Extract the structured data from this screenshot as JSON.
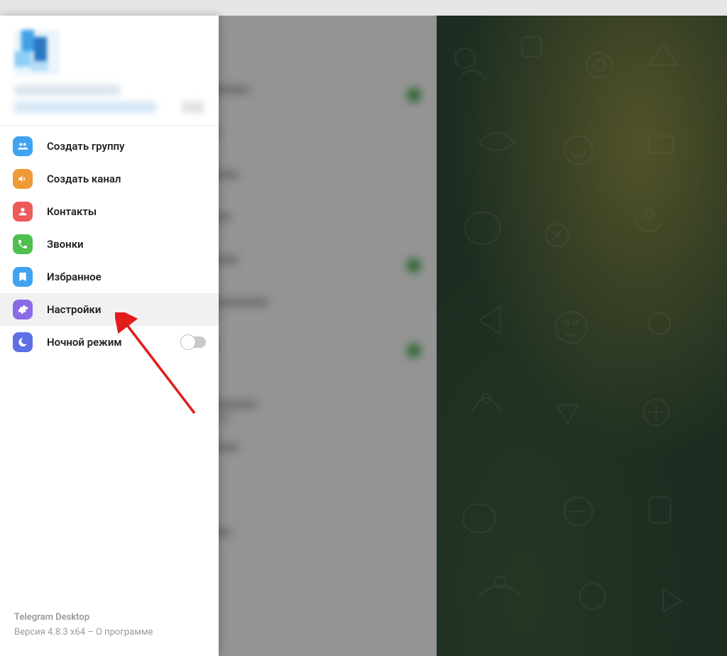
{
  "menu": {
    "new_group": {
      "label": "Создать группу",
      "icon": "group-icon"
    },
    "new_channel": {
      "label": "Создать канал",
      "icon": "megaphone-icon"
    },
    "contacts": {
      "label": "Контакты",
      "icon": "contact-icon"
    },
    "calls": {
      "label": "Звонки",
      "icon": "phone-icon"
    },
    "saved": {
      "label": "Избранное",
      "icon": "bookmark-icon"
    },
    "settings": {
      "label": "Настройки",
      "icon": "gear-icon"
    },
    "night_mode": {
      "label": "Ночной режим",
      "icon": "moon-icon",
      "enabled": false
    }
  },
  "footer": {
    "app_name": "Telegram Desktop",
    "version_prefix": "Версия 4.8.3 x64 – ",
    "about": "О программе"
  }
}
